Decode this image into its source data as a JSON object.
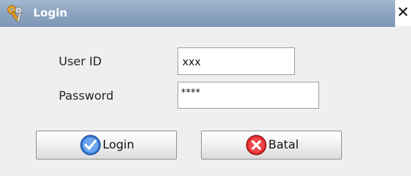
{
  "window": {
    "title": "Login",
    "close_glyph": "✕"
  },
  "form": {
    "user_id_label": "User ID",
    "user_id_value": "xxx",
    "password_label": "Password",
    "password_value": "****"
  },
  "buttons": {
    "login_label": "Login",
    "login_icon": "check-circle-icon",
    "cancel_label": "Batal",
    "cancel_icon": "x-circle-icon"
  },
  "colors": {
    "titlebar": "#8ea6c3",
    "login_icon": "#3b7fd8",
    "cancel_icon": "#e02d2d"
  }
}
